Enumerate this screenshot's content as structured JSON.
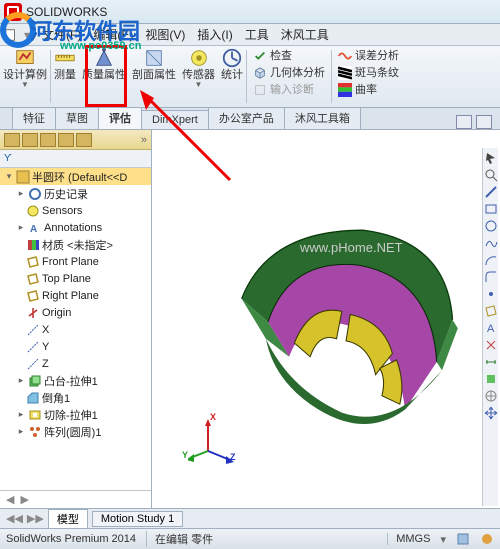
{
  "title": "SOLIDWORKS",
  "menu": {
    "file": "文件(F)",
    "edit": "编辑(E)",
    "view": "视图(V)",
    "insert": "插入(I)",
    "tools": "工具",
    "mofeng": "沐风工具"
  },
  "ribbon": {
    "design_case": "设计算例",
    "measure": "测量",
    "mass_prop": "质量属性",
    "section_prop": "剖面属性",
    "sensor": "传感器",
    "stats": "统计",
    "check": "检查",
    "geom_analysis": "几何体分析",
    "input_diag": "输入诊断",
    "err_analysis": "误差分析",
    "zebra": "斑马条纹",
    "curvature": "曲率"
  },
  "tabs": {
    "feature": "特征",
    "sketch": "草图",
    "evaluate": "评估",
    "dimxpert": "DimXpert",
    "office": "办公室产品",
    "mofeng": "沐风工具箱"
  },
  "tree": {
    "root": "半圆环 (Default<<D",
    "history": "历史记录",
    "sensors": "Sensors",
    "annotations": "Annotations",
    "material": "材质 <未指定>",
    "front": "Front Plane",
    "top": "Top Plane",
    "right": "Right Plane",
    "origin": "Origin",
    "x": "X",
    "y": "Y",
    "z": "Z",
    "boss": "凸台-拉伸1",
    "chamfer": "倒角1",
    "cut": "切除-拉伸1",
    "array": "阵列(圆周)1"
  },
  "triad": {
    "x": "X",
    "y": "Y",
    "z": "Z"
  },
  "bottom_tabs": {
    "model": "模型",
    "motion": "Motion Study 1"
  },
  "status": {
    "app": "SolidWorks Premium 2014",
    "state": "在编辑 零件",
    "units": "MMGS"
  },
  "watermark": {
    "site": "河东软件园",
    "url": "www.pc0359.cn",
    "phome": "www.pHome.NET"
  },
  "filter": "ϒ"
}
